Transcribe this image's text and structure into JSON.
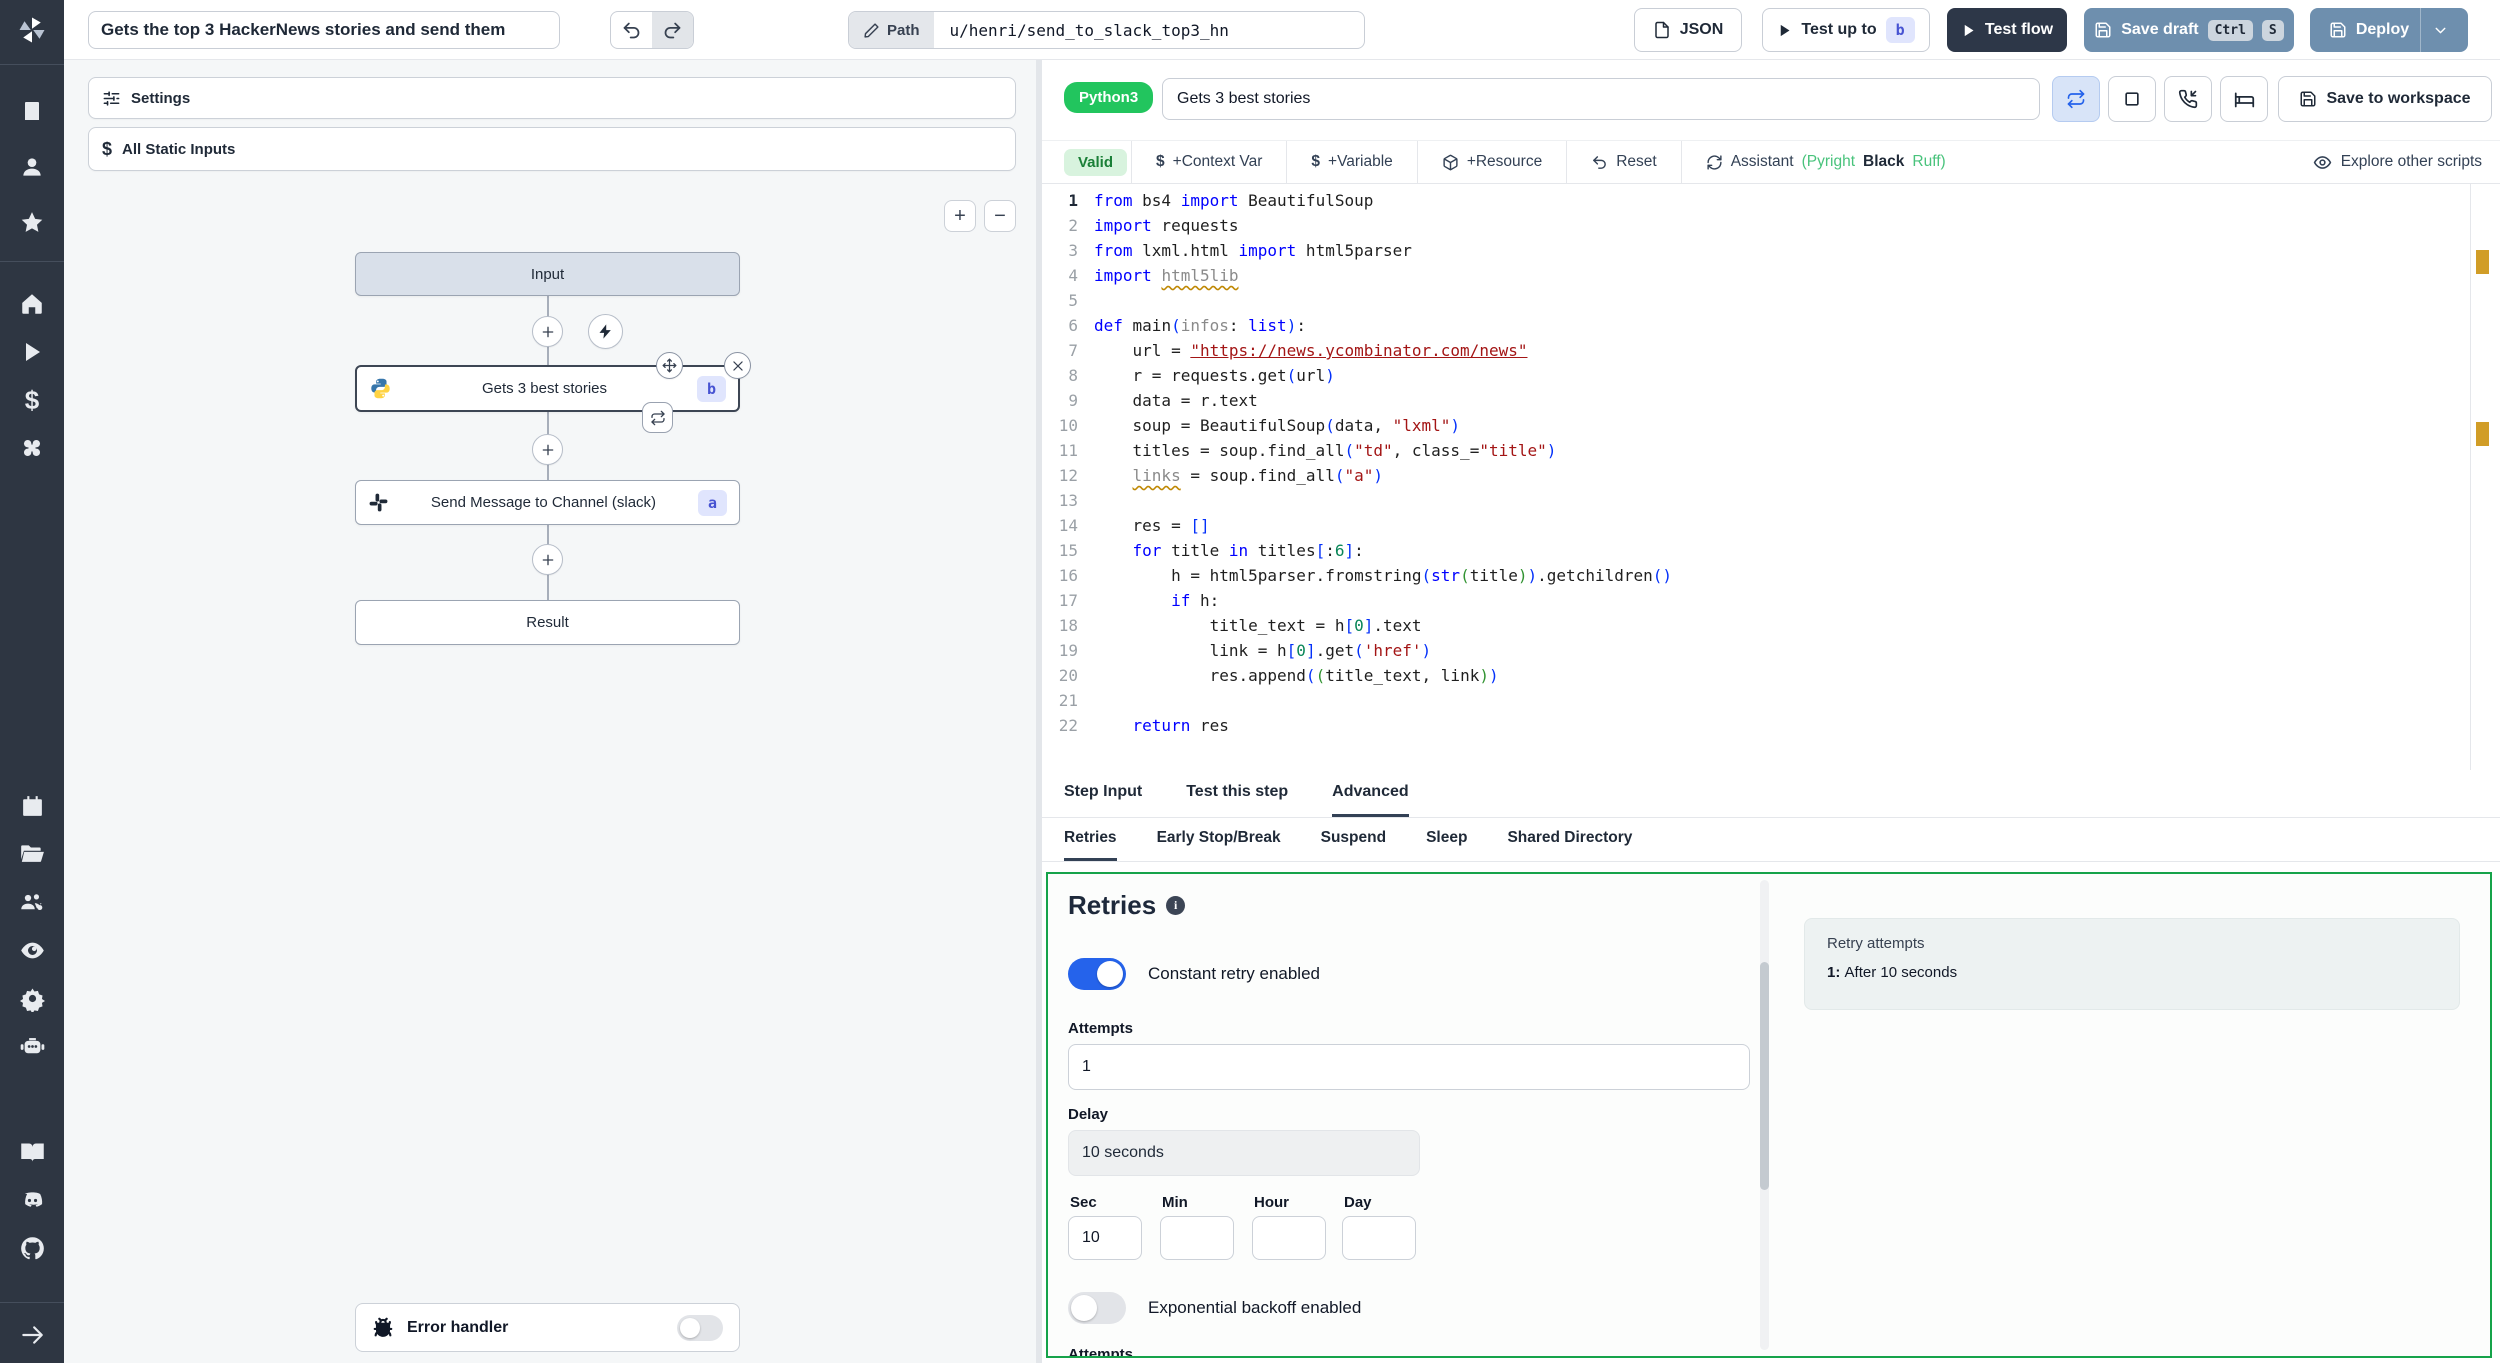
{
  "icons": {
    "logo": "windmill-pinwheel",
    "org": "building",
    "user": "person",
    "favorites": "star",
    "home": "home",
    "runs": "play",
    "variables": "dollar",
    "resources": "cubes",
    "schedules": "calendar",
    "folders": "folder-open",
    "groups": "users-gear",
    "audit": "eye",
    "settings": "gear",
    "workers": "robot",
    "docs": "book-open",
    "discord": "discord",
    "github": "github",
    "collapse": "arrow-right",
    "undo": "undo-arrow",
    "redo": "redo-arrow",
    "edit": "pencil",
    "json": "file",
    "play": "play-triangle",
    "save": "floppy-disk",
    "chevron": "chevron-down",
    "retry": "repeat-arrows",
    "stop": "square",
    "suspend": "phone-incoming",
    "sleep": "bed",
    "resource": "package-box",
    "reset": "undo-arrow",
    "assistant": "refresh-arrows",
    "explore": "eye",
    "info": "info-circle",
    "bug": "bug",
    "lightning": "bolt",
    "move": "move-cross",
    "close": "x",
    "add": "plus",
    "python": "python-logo",
    "slack": "slack-pinwheel",
    "sliders": "settings-sliders"
  },
  "topbar": {
    "flow_title": "Gets the top 3 HackerNews stories and send them",
    "path_label": "Path",
    "path_value": "u/henri/send_to_slack_top3_hn",
    "json_button": "JSON",
    "test_up_to": "Test up to",
    "test_up_to_badge": "b",
    "test_flow": "Test flow",
    "save_draft": "Save draft",
    "kbd": [
      "Ctrl",
      "S"
    ],
    "deploy": "Deploy"
  },
  "flow_panel": {
    "settings": "Settings",
    "all_static_inputs": "All Static Inputs",
    "zoom_in": "+",
    "zoom_out": "−",
    "nodes": {
      "input": "Input",
      "step_b": {
        "label": "Gets 3 best stories",
        "badge": "b"
      },
      "step_a": {
        "label": "Send Message to Channel (slack)",
        "badge": "a"
      },
      "result": "Result"
    },
    "error_handler": "Error handler"
  },
  "editor": {
    "lang_badge": "Python3",
    "script_name": "Gets 3 best stories",
    "save_to_workspace": "Save to workspace",
    "toolbar": {
      "valid": "Valid",
      "context_var": "+Context Var",
      "variable": "+Variable",
      "resource": "+Resource",
      "reset": "Reset",
      "assistant": "Assistant",
      "assistant_pyright": "(Pyright",
      "assistant_black": "Black",
      "assistant_ruff": "Ruff)",
      "explore": "Explore other scripts"
    },
    "code_lines": [
      {
        "n": 1,
        "seg": [
          [
            "k",
            "from"
          ],
          [
            "d",
            " bs4 "
          ],
          [
            "k",
            "import"
          ],
          [
            "d",
            " BeautifulSoup"
          ]
        ]
      },
      {
        "n": 2,
        "seg": [
          [
            "k",
            "import"
          ],
          [
            "d",
            " requests"
          ]
        ]
      },
      {
        "n": 3,
        "seg": [
          [
            "k",
            "from"
          ],
          [
            "d",
            " lxml.html "
          ],
          [
            "k",
            "import"
          ],
          [
            "d",
            " html5parser"
          ]
        ]
      },
      {
        "n": 4,
        "seg": [
          [
            "k",
            "import"
          ],
          [
            "d",
            " "
          ],
          [
            "gw",
            "html5lib"
          ]
        ]
      },
      {
        "n": 5,
        "seg": []
      },
      {
        "n": 6,
        "seg": [
          [
            "k",
            "def"
          ],
          [
            "d",
            " main"
          ],
          [
            "b1",
            "("
          ],
          [
            "g",
            "infos"
          ],
          [
            "d",
            ": "
          ],
          [
            "t",
            "list"
          ],
          [
            "b1",
            ")"
          ],
          [
            "d",
            ":"
          ]
        ]
      },
      {
        "n": 7,
        "seg": [
          [
            "d",
            "    url = "
          ],
          [
            "u",
            "\"https://news.ycombinator.com/news\""
          ]
        ]
      },
      {
        "n": 8,
        "seg": [
          [
            "d",
            "    r = requests.get"
          ],
          [
            "b1",
            "("
          ],
          [
            "d",
            "url"
          ],
          [
            "b1",
            ")"
          ]
        ]
      },
      {
        "n": 9,
        "seg": [
          [
            "d",
            "    data = r.text"
          ]
        ]
      },
      {
        "n": 10,
        "seg": [
          [
            "d",
            "    soup = BeautifulSoup"
          ],
          [
            "b1",
            "("
          ],
          [
            "d",
            "data, "
          ],
          [
            "s",
            "\"lxml\""
          ],
          [
            "b1",
            ")"
          ]
        ]
      },
      {
        "n": 11,
        "seg": [
          [
            "d",
            "    titles = soup.find_all"
          ],
          [
            "b1",
            "("
          ],
          [
            "s",
            "\"td\""
          ],
          [
            "d",
            ", class_="
          ],
          [
            "s",
            "\"title\""
          ],
          [
            "b1",
            ")"
          ]
        ]
      },
      {
        "n": 12,
        "seg": [
          [
            "d",
            "    "
          ],
          [
            "gw",
            "links"
          ],
          [
            "d",
            " = soup.find_all"
          ],
          [
            "b1",
            "("
          ],
          [
            "s",
            "\"a\""
          ],
          [
            "b1",
            ")"
          ]
        ]
      },
      {
        "n": 13,
        "seg": []
      },
      {
        "n": 14,
        "seg": [
          [
            "d",
            "    res = "
          ],
          [
            "b1",
            "[]"
          ]
        ]
      },
      {
        "n": 15,
        "seg": [
          [
            "d",
            "    "
          ],
          [
            "k",
            "for"
          ],
          [
            "d",
            " title "
          ],
          [
            "k",
            "in"
          ],
          [
            "d",
            " titles"
          ],
          [
            "b1",
            "["
          ],
          [
            "d",
            ":"
          ],
          [
            "n",
            "6"
          ],
          [
            "b1",
            "]"
          ],
          [
            "d",
            ":"
          ]
        ]
      },
      {
        "n": 16,
        "seg": [
          [
            "d",
            "        h = html5parser.fromstring"
          ],
          [
            "b1",
            "("
          ],
          [
            "t",
            "str"
          ],
          [
            "b2",
            "("
          ],
          [
            "d",
            "title"
          ],
          [
            "b2",
            ")"
          ],
          [
            "b1",
            ")"
          ],
          [
            "d",
            ".getchildren"
          ],
          [
            "b1",
            "()"
          ]
        ]
      },
      {
        "n": 17,
        "seg": [
          [
            "d",
            "        "
          ],
          [
            "k",
            "if"
          ],
          [
            "d",
            " h:"
          ]
        ]
      },
      {
        "n": 18,
        "seg": [
          [
            "d",
            "            title_text = h"
          ],
          [
            "b1",
            "["
          ],
          [
            "n",
            "0"
          ],
          [
            "b1",
            "]"
          ],
          [
            "d",
            ".text"
          ]
        ]
      },
      {
        "n": 19,
        "seg": [
          [
            "d",
            "            link = h"
          ],
          [
            "b1",
            "["
          ],
          [
            "n",
            "0"
          ],
          [
            "b1",
            "]"
          ],
          [
            "d",
            ".get"
          ],
          [
            "b1",
            "("
          ],
          [
            "s",
            "'href'"
          ],
          [
            "b1",
            ")"
          ]
        ]
      },
      {
        "n": 20,
        "seg": [
          [
            "d",
            "            res.append"
          ],
          [
            "b1",
            "("
          ],
          [
            "b2",
            "("
          ],
          [
            "d",
            "title_text, link"
          ],
          [
            "b2",
            ")"
          ],
          [
            "b1",
            ")"
          ]
        ]
      },
      {
        "n": 21,
        "seg": []
      },
      {
        "n": 22,
        "seg": [
          [
            "d",
            "    "
          ],
          [
            "k",
            "return"
          ],
          [
            "d",
            " res"
          ]
        ]
      }
    ]
  },
  "tabs": {
    "main": [
      "Step Input",
      "Test this step",
      "Advanced"
    ],
    "main_active": "Advanced",
    "sub": [
      "Retries",
      "Early Stop/Break",
      "Suspend",
      "Sleep",
      "Shared Directory"
    ],
    "sub_active": "Retries"
  },
  "retries": {
    "title": "Retries",
    "constant_toggle_label": "Constant retry enabled",
    "attempts_label": "Attempts",
    "attempts_value": "1",
    "delay_label": "Delay",
    "delay_value": "10 seconds",
    "time_labels": [
      "Sec",
      "Min",
      "Hour",
      "Day"
    ],
    "sec_value": "10",
    "exponential_toggle_label": "Exponential backoff enabled",
    "attempts_label_2": "Attempts",
    "preview": {
      "title": "Retry attempts",
      "attempt_prefix": "1:",
      "attempt_text": "After 10 seconds"
    }
  },
  "colors": {
    "sidebar_bg": "#2e3642",
    "steel_blue": "#6e8fae",
    "dark_button": "#2d3748",
    "lang_green": "#22c55e",
    "valid_green": "#1a7f37",
    "panel_border_green": "#16a34a",
    "toggle_blue": "#2563eb",
    "badge_indigo": "#4753d2",
    "warning_marker": "#d19d27"
  }
}
